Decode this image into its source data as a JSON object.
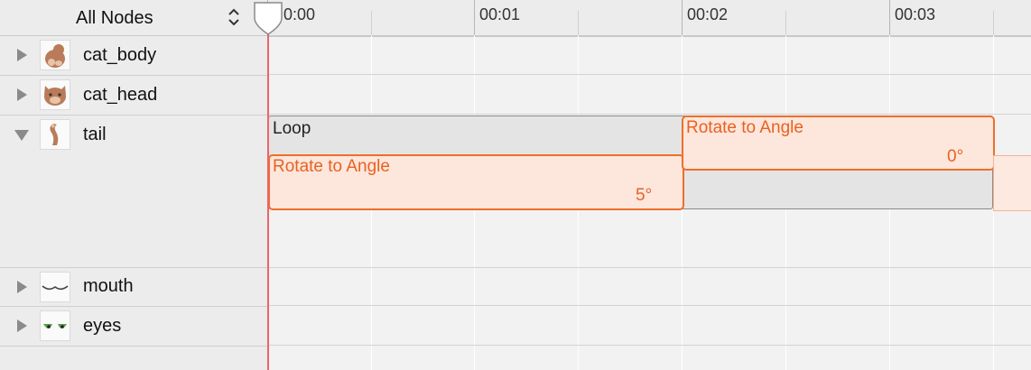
{
  "filter": {
    "label": "All Nodes"
  },
  "nodes": [
    {
      "name": "cat_body",
      "icon": "cat-body-thumbnail-icon",
      "expanded": false
    },
    {
      "name": "cat_head",
      "icon": "cat-head-thumbnail-icon",
      "expanded": false
    },
    {
      "name": "tail",
      "icon": "tail-thumbnail-icon",
      "expanded": true
    },
    {
      "name": "mouth",
      "icon": "mouth-thumbnail-icon",
      "expanded": false
    },
    {
      "name": "eyes",
      "icon": "eyes-thumbnail-icon",
      "expanded": false
    }
  ],
  "ruler": {
    "ticks": [
      "0:00",
      "00:01",
      "00:02",
      "00:03"
    ]
  },
  "actions": {
    "loop": {
      "label": "Loop"
    },
    "rotate_a": {
      "title": "Rotate to Angle",
      "value": "5°"
    },
    "rotate_b": {
      "title": "Rotate to Angle",
      "value": "0°"
    }
  },
  "colors": {
    "accent": "#ee6f2a",
    "action_fill": "#fde6dc",
    "playhead": "#f0636a",
    "loop_fill": "#e4e4e4"
  }
}
